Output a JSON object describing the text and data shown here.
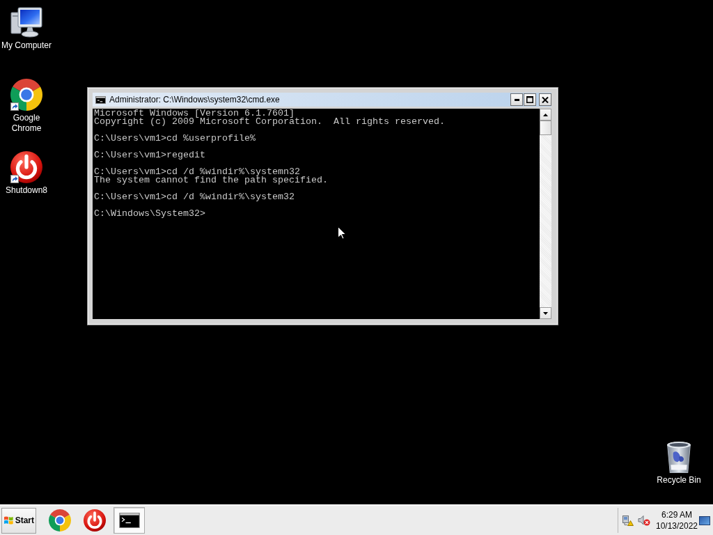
{
  "desktop": {
    "icons": [
      {
        "kind": "computer",
        "label": "My Computer",
        "shortcut": false
      },
      {
        "kind": "browser",
        "label": "Google Chrome",
        "shortcut": true
      },
      {
        "kind": "power",
        "label": "Shutdown8",
        "shortcut": true
      },
      {
        "kind": "trash",
        "label": "Recycle Bin",
        "shortcut": false
      }
    ]
  },
  "window": {
    "title": "Administrator: C:\\Windows\\system32\\cmd.exe",
    "console": [
      {
        "lines": [
          "Microsoft Windows [Version 6.1.7601]",
          "Copyright (c) 2009 Microsoft Corporation.  All rights reserved."
        ]
      },
      {
        "lines": [
          "C:\\Users\\vm1>cd %userprofile%"
        ]
      },
      {
        "lines": [
          "C:\\Users\\vm1>regedit"
        ]
      },
      {
        "lines": [
          "C:\\Users\\vm1>cd /d %windir%\\systemn32",
          "The system cannot find the path specified."
        ]
      },
      {
        "lines": [
          "C:\\Users\\vm1>cd /d %windir%\\system32"
        ]
      },
      {
        "lines": [
          "C:\\Windows\\System32>"
        ]
      }
    ]
  },
  "taskbar": {
    "start": {
      "label": "Start"
    },
    "items": [
      {
        "kind": "browser",
        "selected": false
      },
      {
        "kind": "power",
        "selected": false
      },
      {
        "kind": "console",
        "selected": true
      }
    ],
    "clock": {
      "time": "6:29 AM",
      "date": "10/13/2022"
    }
  }
}
